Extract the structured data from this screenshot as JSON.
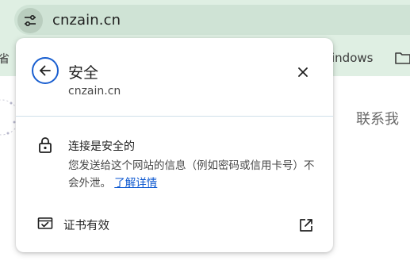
{
  "browser": {
    "url": "cnzain.cn",
    "bookmarks": {
      "left_fragment": "省",
      "right_item": "indows"
    }
  },
  "page": {
    "right_text": "联系我"
  },
  "popup": {
    "title": "安全",
    "subtitle": "cnzain.cn",
    "connection": {
      "title": "连接是安全的",
      "description": "您发送给这个网站的信息（例如密码或信用卡号）不会外泄。",
      "learn_more": "了解详情"
    },
    "certificate": {
      "label": "证书有效"
    }
  },
  "colors": {
    "accent": "#1a5fd0",
    "link": "#0b57d0",
    "toolbar": "#dfefe3",
    "omnibox": "#cfe3d5"
  },
  "icons": {
    "tune": "tune-icon",
    "back": "arrow-left-icon",
    "close": "close-icon",
    "lock": "lock-icon",
    "certificate": "certificate-icon",
    "open_external": "open-in-new-icon",
    "folder": "folder-icon"
  }
}
